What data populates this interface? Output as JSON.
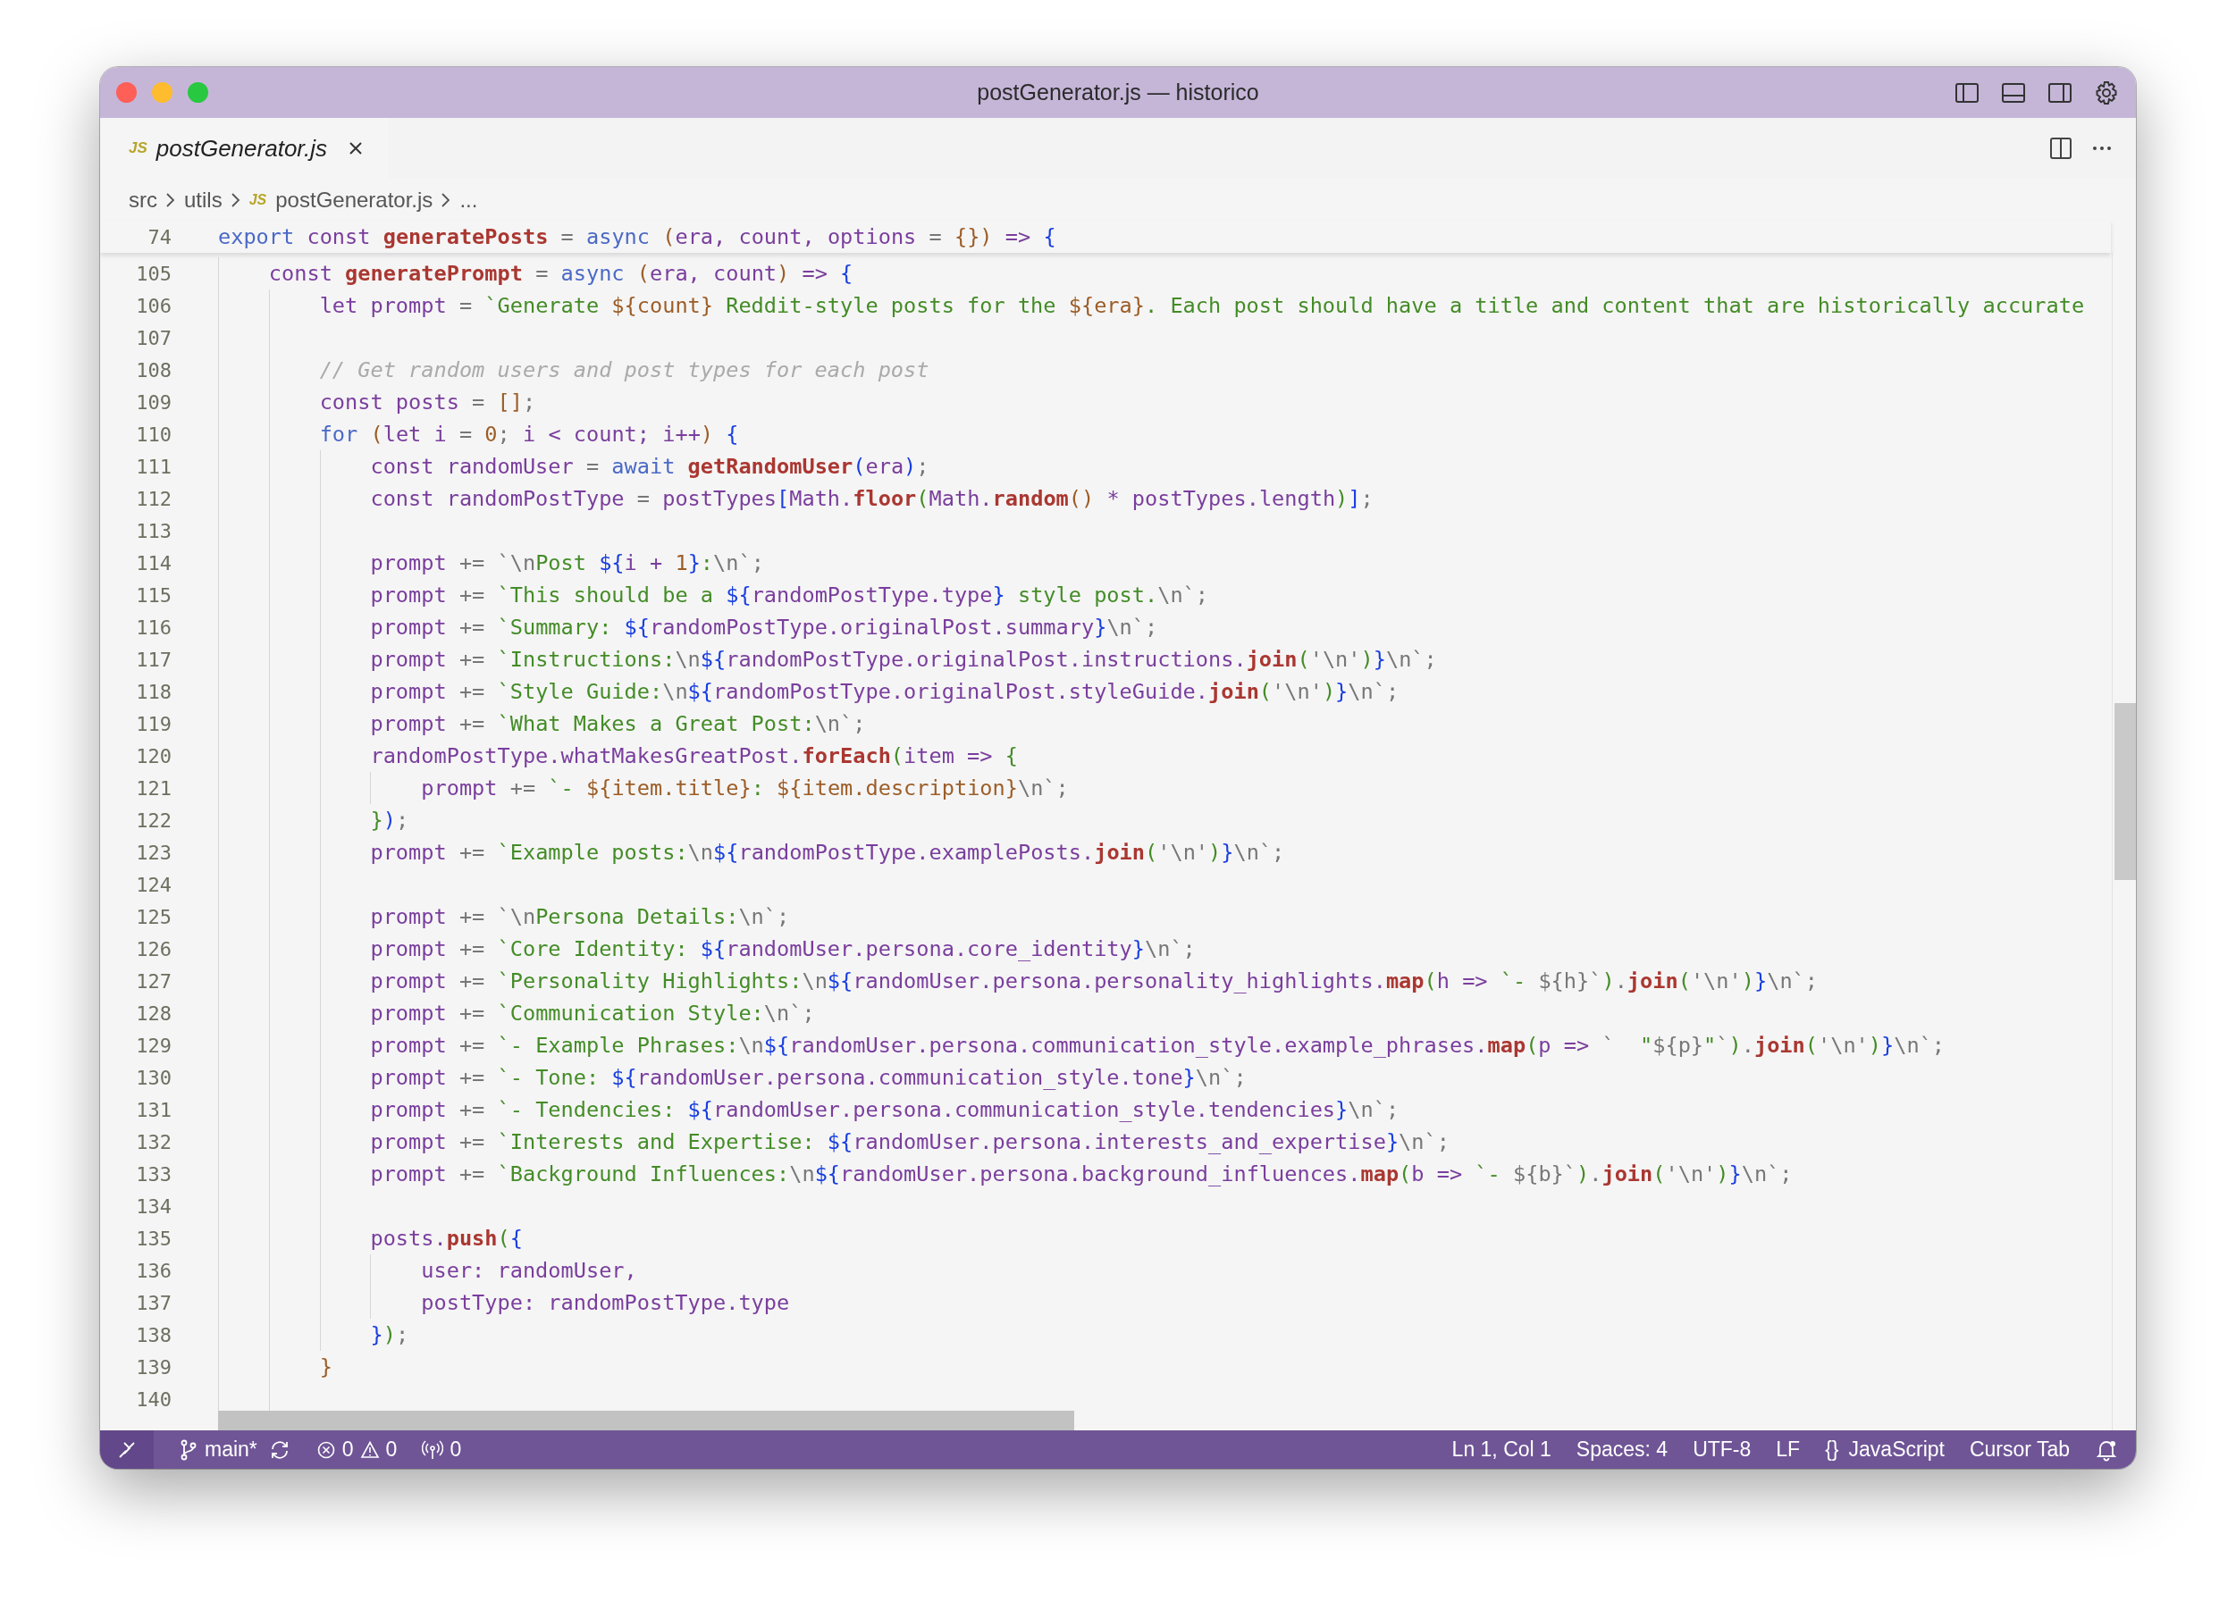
{
  "window": {
    "title": "postGenerator.js — historico"
  },
  "tabs": [
    {
      "icon_text": "JS",
      "label": "postGenerator.js",
      "selected": true
    }
  ],
  "breadcrumb": [
    {
      "label": "src"
    },
    {
      "label": "utils"
    },
    {
      "icon_text": "JS",
      "label": "postGenerator.js"
    },
    {
      "label": "..."
    }
  ],
  "sticky_line": {
    "number": "74",
    "tokens": [
      {
        "kind": "kw",
        "text": "export "
      },
      {
        "kind": "id",
        "text": "const "
      },
      {
        "kind": "fn",
        "text": "generatePosts"
      },
      {
        "kind": "op",
        "text": " = "
      },
      {
        "kind": "kw",
        "text": "async "
      },
      {
        "kind": "num",
        "text": "("
      },
      {
        "kind": "id",
        "text": "era, count, options "
      },
      {
        "kind": "op",
        "text": "= "
      },
      {
        "kind": "num",
        "text": "{})"
      },
      {
        "kind": "id",
        "text": " => "
      },
      {
        "kind": "tpl",
        "text": "{"
      }
    ]
  },
  "lines": [
    {
      "number": "105",
      "tokens": [
        {
          "kind": "id",
          "text": "    const "
        },
        {
          "kind": "fn",
          "text": "generatePrompt"
        },
        {
          "kind": "op",
          "text": " = "
        },
        {
          "kind": "kw",
          "text": "async "
        },
        {
          "kind": "num",
          "text": "("
        },
        {
          "kind": "id",
          "text": "era, count"
        },
        {
          "kind": "num",
          "text": ") "
        },
        {
          "kind": "id",
          "text": "=> "
        },
        {
          "kind": "tpl",
          "text": "{"
        }
      ]
    },
    {
      "number": "106",
      "tokens": [
        {
          "kind": "id",
          "text": "        let prompt "
        },
        {
          "kind": "op",
          "text": "= "
        },
        {
          "kind": "str",
          "text": "`Generate "
        },
        {
          "kind": "num",
          "text": "${count}"
        },
        {
          "kind": "str",
          "text": " Reddit-style posts for the "
        },
        {
          "kind": "num",
          "text": "${era}"
        },
        {
          "kind": "str",
          "text": ". Each post should have a title and content that are historically accurate"
        }
      ]
    },
    {
      "number": "107"
    },
    {
      "number": "108",
      "tokens": [
        {
          "kind": "cm",
          "text": "        // Get random users and post types for each post"
        }
      ]
    },
    {
      "number": "109",
      "tokens": [
        {
          "kind": "id",
          "text": "        const posts "
        },
        {
          "kind": "op",
          "text": "= "
        },
        {
          "kind": "num",
          "text": "[]"
        },
        {
          "kind": "op",
          "text": ";"
        }
      ]
    },
    {
      "number": "110",
      "tokens": [
        {
          "kind": "kw",
          "text": "        for "
        },
        {
          "kind": "num",
          "text": "("
        },
        {
          "kind": "id",
          "text": "let i "
        },
        {
          "kind": "op",
          "text": "= "
        },
        {
          "kind": "num",
          "text": "0"
        },
        {
          "kind": "op",
          "text": "; "
        },
        {
          "kind": "id",
          "text": "i < count; i++"
        },
        {
          "kind": "num",
          "text": ") "
        },
        {
          "kind": "tpl",
          "text": "{"
        }
      ]
    },
    {
      "number": "111",
      "tokens": [
        {
          "kind": "id",
          "text": "            const randomUser "
        },
        {
          "kind": "op",
          "text": "= "
        },
        {
          "kind": "kw",
          "text": "await "
        },
        {
          "kind": "fn",
          "text": "getRandomUser"
        },
        {
          "kind": "tpl",
          "text": "("
        },
        {
          "kind": "id",
          "text": "era"
        },
        {
          "kind": "tpl",
          "text": ")"
        },
        {
          "kind": "op",
          "text": ";"
        }
      ]
    },
    {
      "number": "112",
      "tokens": [
        {
          "kind": "id",
          "text": "            const randomPostType "
        },
        {
          "kind": "op",
          "text": "= "
        },
        {
          "kind": "id",
          "text": "postTypes"
        },
        {
          "kind": "tpl",
          "text": "["
        },
        {
          "kind": "id",
          "text": "Math."
        },
        {
          "kind": "fn",
          "text": "floor"
        },
        {
          "kind": "str",
          "text": "("
        },
        {
          "kind": "id",
          "text": "Math."
        },
        {
          "kind": "fn",
          "text": "random"
        },
        {
          "kind": "num",
          "text": "() "
        },
        {
          "kind": "id",
          "text": "* postTypes.length"
        },
        {
          "kind": "str",
          "text": ")"
        },
        {
          "kind": "tpl",
          "text": "]"
        },
        {
          "kind": "op",
          "text": ";"
        }
      ]
    },
    {
      "number": "113"
    },
    {
      "number": "114",
      "tokens": [
        {
          "kind": "id",
          "text": "            prompt "
        },
        {
          "kind": "op",
          "text": "+= `\\n"
        },
        {
          "kind": "str",
          "text": "Post "
        },
        {
          "kind": "tpl",
          "text": "${"
        },
        {
          "kind": "id",
          "text": "i + "
        },
        {
          "kind": "num",
          "text": "1"
        },
        {
          "kind": "tpl",
          "text": "}"
        },
        {
          "kind": "str",
          "text": ":"
        },
        {
          "kind": "op",
          "text": "\\n`;"
        }
      ]
    },
    {
      "number": "115",
      "tokens": [
        {
          "kind": "id",
          "text": "            prompt "
        },
        {
          "kind": "op",
          "text": "+= "
        },
        {
          "kind": "str",
          "text": "`This should be a "
        },
        {
          "kind": "tpl",
          "text": "${"
        },
        {
          "kind": "id",
          "text": "randomPostType.type"
        },
        {
          "kind": "tpl",
          "text": "}"
        },
        {
          "kind": "str",
          "text": " style post."
        },
        {
          "kind": "op",
          "text": "\\n`;"
        }
      ]
    },
    {
      "number": "116",
      "tokens": [
        {
          "kind": "id",
          "text": "            prompt "
        },
        {
          "kind": "op",
          "text": "+= "
        },
        {
          "kind": "str",
          "text": "`Summary: "
        },
        {
          "kind": "tpl",
          "text": "${"
        },
        {
          "kind": "id",
          "text": "randomPostType.originalPost.summary"
        },
        {
          "kind": "tpl",
          "text": "}"
        },
        {
          "kind": "op",
          "text": "\\n`;"
        }
      ]
    },
    {
      "number": "117",
      "tokens": [
        {
          "kind": "id",
          "text": "            prompt "
        },
        {
          "kind": "op",
          "text": "+= "
        },
        {
          "kind": "str",
          "text": "`Instructions:"
        },
        {
          "kind": "op",
          "text": "\\n"
        },
        {
          "kind": "tpl",
          "text": "${"
        },
        {
          "kind": "id",
          "text": "randomPostType.originalPost.instructions."
        },
        {
          "kind": "fn",
          "text": "join"
        },
        {
          "kind": "str",
          "text": "("
        },
        {
          "kind": "op",
          "text": "'\\n'"
        },
        {
          "kind": "str",
          "text": ")"
        },
        {
          "kind": "tpl",
          "text": "}"
        },
        {
          "kind": "op",
          "text": "\\n`;"
        }
      ]
    },
    {
      "number": "118",
      "tokens": [
        {
          "kind": "id",
          "text": "            prompt "
        },
        {
          "kind": "op",
          "text": "+= "
        },
        {
          "kind": "str",
          "text": "`Style Guide:"
        },
        {
          "kind": "op",
          "text": "\\n"
        },
        {
          "kind": "tpl",
          "text": "${"
        },
        {
          "kind": "id",
          "text": "randomPostType.originalPost.styleGuide."
        },
        {
          "kind": "fn",
          "text": "join"
        },
        {
          "kind": "str",
          "text": "("
        },
        {
          "kind": "op",
          "text": "'\\n'"
        },
        {
          "kind": "str",
          "text": ")"
        },
        {
          "kind": "tpl",
          "text": "}"
        },
        {
          "kind": "op",
          "text": "\\n`;"
        }
      ]
    },
    {
      "number": "119",
      "tokens": [
        {
          "kind": "id",
          "text": "            prompt "
        },
        {
          "kind": "op",
          "text": "+= "
        },
        {
          "kind": "str",
          "text": "`What Makes a Great Post:"
        },
        {
          "kind": "op",
          "text": "\\n`;"
        }
      ]
    },
    {
      "number": "120",
      "tokens": [
        {
          "kind": "id",
          "text": "            randomPostType.whatMakesGreatPost."
        },
        {
          "kind": "fn",
          "text": "forEach"
        },
        {
          "kind": "str",
          "text": "("
        },
        {
          "kind": "id",
          "text": "item => "
        },
        {
          "kind": "str",
          "text": "{"
        }
      ]
    },
    {
      "number": "121",
      "tokens": [
        {
          "kind": "id",
          "text": "                prompt "
        },
        {
          "kind": "op",
          "text": "+= "
        },
        {
          "kind": "str",
          "text": "`- "
        },
        {
          "kind": "num",
          "text": "${item.title}"
        },
        {
          "kind": "str",
          "text": ": "
        },
        {
          "kind": "num",
          "text": "${item.description}"
        },
        {
          "kind": "op",
          "text": "\\n`;"
        }
      ]
    },
    {
      "number": "122",
      "tokens": [
        {
          "kind": "str",
          "text": "            }"
        },
        {
          "kind": "tpl",
          "text": ")"
        },
        {
          "kind": "op",
          "text": ";"
        }
      ]
    },
    {
      "number": "123",
      "tokens": [
        {
          "kind": "id",
          "text": "            prompt "
        },
        {
          "kind": "op",
          "text": "+= "
        },
        {
          "kind": "str",
          "text": "`Example posts:"
        },
        {
          "kind": "op",
          "text": "\\n"
        },
        {
          "kind": "tpl",
          "text": "${"
        },
        {
          "kind": "id",
          "text": "randomPostType.examplePosts."
        },
        {
          "kind": "fn",
          "text": "join"
        },
        {
          "kind": "str",
          "text": "("
        },
        {
          "kind": "op",
          "text": "'\\n'"
        },
        {
          "kind": "str",
          "text": ")"
        },
        {
          "kind": "tpl",
          "text": "}"
        },
        {
          "kind": "op",
          "text": "\\n`;"
        }
      ]
    },
    {
      "number": "124"
    },
    {
      "number": "125",
      "tokens": [
        {
          "kind": "id",
          "text": "            prompt "
        },
        {
          "kind": "op",
          "text": "+= `\\n"
        },
        {
          "kind": "str",
          "text": "Persona Details:"
        },
        {
          "kind": "op",
          "text": "\\n`;"
        }
      ]
    },
    {
      "number": "126",
      "tokens": [
        {
          "kind": "id",
          "text": "            prompt "
        },
        {
          "kind": "op",
          "text": "+= "
        },
        {
          "kind": "str",
          "text": "`Core Identity: "
        },
        {
          "kind": "tpl",
          "text": "${"
        },
        {
          "kind": "id",
          "text": "randomUser.persona.core_identity"
        },
        {
          "kind": "tpl",
          "text": "}"
        },
        {
          "kind": "op",
          "text": "\\n`;"
        }
      ]
    },
    {
      "number": "127",
      "tokens": [
        {
          "kind": "id",
          "text": "            prompt "
        },
        {
          "kind": "op",
          "text": "+= "
        },
        {
          "kind": "str",
          "text": "`Personality Highlights:"
        },
        {
          "kind": "op",
          "text": "\\n"
        },
        {
          "kind": "tpl",
          "text": "${"
        },
        {
          "kind": "id",
          "text": "randomUser.persona.personality_highlights."
        },
        {
          "kind": "fn",
          "text": "map"
        },
        {
          "kind": "str",
          "text": "("
        },
        {
          "kind": "id",
          "text": "h => "
        },
        {
          "kind": "str",
          "text": "`- "
        },
        {
          "kind": "op",
          "text": "${h}`"
        },
        {
          "kind": "str",
          "text": ")"
        },
        {
          "kind": "op",
          "text": "."
        },
        {
          "kind": "fn",
          "text": "join"
        },
        {
          "kind": "str",
          "text": "("
        },
        {
          "kind": "op",
          "text": "'\\n'"
        },
        {
          "kind": "str",
          "text": ")"
        },
        {
          "kind": "tpl",
          "text": "}"
        },
        {
          "kind": "op",
          "text": "\\n`;"
        }
      ]
    },
    {
      "number": "128",
      "tokens": [
        {
          "kind": "id",
          "text": "            prompt "
        },
        {
          "kind": "op",
          "text": "+= "
        },
        {
          "kind": "str",
          "text": "`Communication Style:"
        },
        {
          "kind": "op",
          "text": "\\n`;"
        }
      ]
    },
    {
      "number": "129",
      "tokens": [
        {
          "kind": "id",
          "text": "            prompt "
        },
        {
          "kind": "op",
          "text": "+= "
        },
        {
          "kind": "str",
          "text": "`- Example Phrases:"
        },
        {
          "kind": "op",
          "text": "\\n"
        },
        {
          "kind": "tpl",
          "text": "${"
        },
        {
          "kind": "id",
          "text": "randomUser.persona.communication_style.example_phrases."
        },
        {
          "kind": "fn",
          "text": "map"
        },
        {
          "kind": "str",
          "text": "("
        },
        {
          "kind": "id",
          "text": "p => "
        },
        {
          "kind": "op",
          "text": "`  "
        },
        {
          "kind": "str",
          "text": "\""
        },
        {
          "kind": "op",
          "text": "${p}"
        },
        {
          "kind": "str",
          "text": "\""
        },
        {
          "kind": "op",
          "text": "`"
        },
        {
          "kind": "str",
          "text": ")"
        },
        {
          "kind": "op",
          "text": "."
        },
        {
          "kind": "fn",
          "text": "join"
        },
        {
          "kind": "str",
          "text": "("
        },
        {
          "kind": "op",
          "text": "'\\n'"
        },
        {
          "kind": "str",
          "text": ")"
        },
        {
          "kind": "tpl",
          "text": "}"
        },
        {
          "kind": "op",
          "text": "\\n`;"
        }
      ]
    },
    {
      "number": "130",
      "tokens": [
        {
          "kind": "id",
          "text": "            prompt "
        },
        {
          "kind": "op",
          "text": "+= "
        },
        {
          "kind": "str",
          "text": "`- Tone: "
        },
        {
          "kind": "tpl",
          "text": "${"
        },
        {
          "kind": "id",
          "text": "randomUser.persona.communication_style.tone"
        },
        {
          "kind": "tpl",
          "text": "}"
        },
        {
          "kind": "op",
          "text": "\\n`;"
        }
      ]
    },
    {
      "number": "131",
      "tokens": [
        {
          "kind": "id",
          "text": "            prompt "
        },
        {
          "kind": "op",
          "text": "+= "
        },
        {
          "kind": "str",
          "text": "`- Tendencies: "
        },
        {
          "kind": "tpl",
          "text": "${"
        },
        {
          "kind": "id",
          "text": "randomUser.persona.communication_style.tendencies"
        },
        {
          "kind": "tpl",
          "text": "}"
        },
        {
          "kind": "op",
          "text": "\\n`;"
        }
      ]
    },
    {
      "number": "132",
      "tokens": [
        {
          "kind": "id",
          "text": "            prompt "
        },
        {
          "kind": "op",
          "text": "+= "
        },
        {
          "kind": "str",
          "text": "`Interests and Expertise: "
        },
        {
          "kind": "tpl",
          "text": "${"
        },
        {
          "kind": "id",
          "text": "randomUser.persona.interests_and_expertise"
        },
        {
          "kind": "tpl",
          "text": "}"
        },
        {
          "kind": "op",
          "text": "\\n`;"
        }
      ]
    },
    {
      "number": "133",
      "tokens": [
        {
          "kind": "id",
          "text": "            prompt "
        },
        {
          "kind": "op",
          "text": "+= "
        },
        {
          "kind": "str",
          "text": "`Background Influences:"
        },
        {
          "kind": "op",
          "text": "\\n"
        },
        {
          "kind": "tpl",
          "text": "${"
        },
        {
          "kind": "id",
          "text": "randomUser.persona.background_influences."
        },
        {
          "kind": "fn",
          "text": "map"
        },
        {
          "kind": "str",
          "text": "("
        },
        {
          "kind": "id",
          "text": "b => "
        },
        {
          "kind": "str",
          "text": "`- "
        },
        {
          "kind": "op",
          "text": "${b}`"
        },
        {
          "kind": "str",
          "text": ")"
        },
        {
          "kind": "op",
          "text": "."
        },
        {
          "kind": "fn",
          "text": "join"
        },
        {
          "kind": "str",
          "text": "("
        },
        {
          "kind": "op",
          "text": "'\\n'"
        },
        {
          "kind": "str",
          "text": ")"
        },
        {
          "kind": "tpl",
          "text": "}"
        },
        {
          "kind": "op",
          "text": "\\n`;"
        }
      ]
    },
    {
      "number": "134"
    },
    {
      "number": "135",
      "tokens": [
        {
          "kind": "id",
          "text": "            posts."
        },
        {
          "kind": "fn",
          "text": "push"
        },
        {
          "kind": "str",
          "text": "("
        },
        {
          "kind": "tpl",
          "text": "{"
        }
      ]
    },
    {
      "number": "136",
      "tokens": [
        {
          "kind": "id",
          "text": "                user: randomUser,"
        }
      ]
    },
    {
      "number": "137",
      "tokens": [
        {
          "kind": "id",
          "text": "                postType: randomPostType.type"
        }
      ]
    },
    {
      "number": "138",
      "tokens": [
        {
          "kind": "tpl",
          "text": "            }"
        },
        {
          "kind": "str",
          "text": ")"
        },
        {
          "kind": "op",
          "text": ";"
        }
      ]
    },
    {
      "number": "139",
      "tokens": [
        {
          "kind": "num",
          "text": "        }"
        }
      ]
    },
    {
      "number": "140"
    }
  ],
  "status_bar": {
    "branch": "main*",
    "errors": "0",
    "warnings": "0",
    "ports": "0",
    "position": "Ln 1, Col 1",
    "indentation": "Spaces: 4",
    "encoding": "UTF-8",
    "eol": "LF",
    "language_icon": "{}",
    "language": "JavaScript",
    "extension": "Cursor Tab"
  }
}
